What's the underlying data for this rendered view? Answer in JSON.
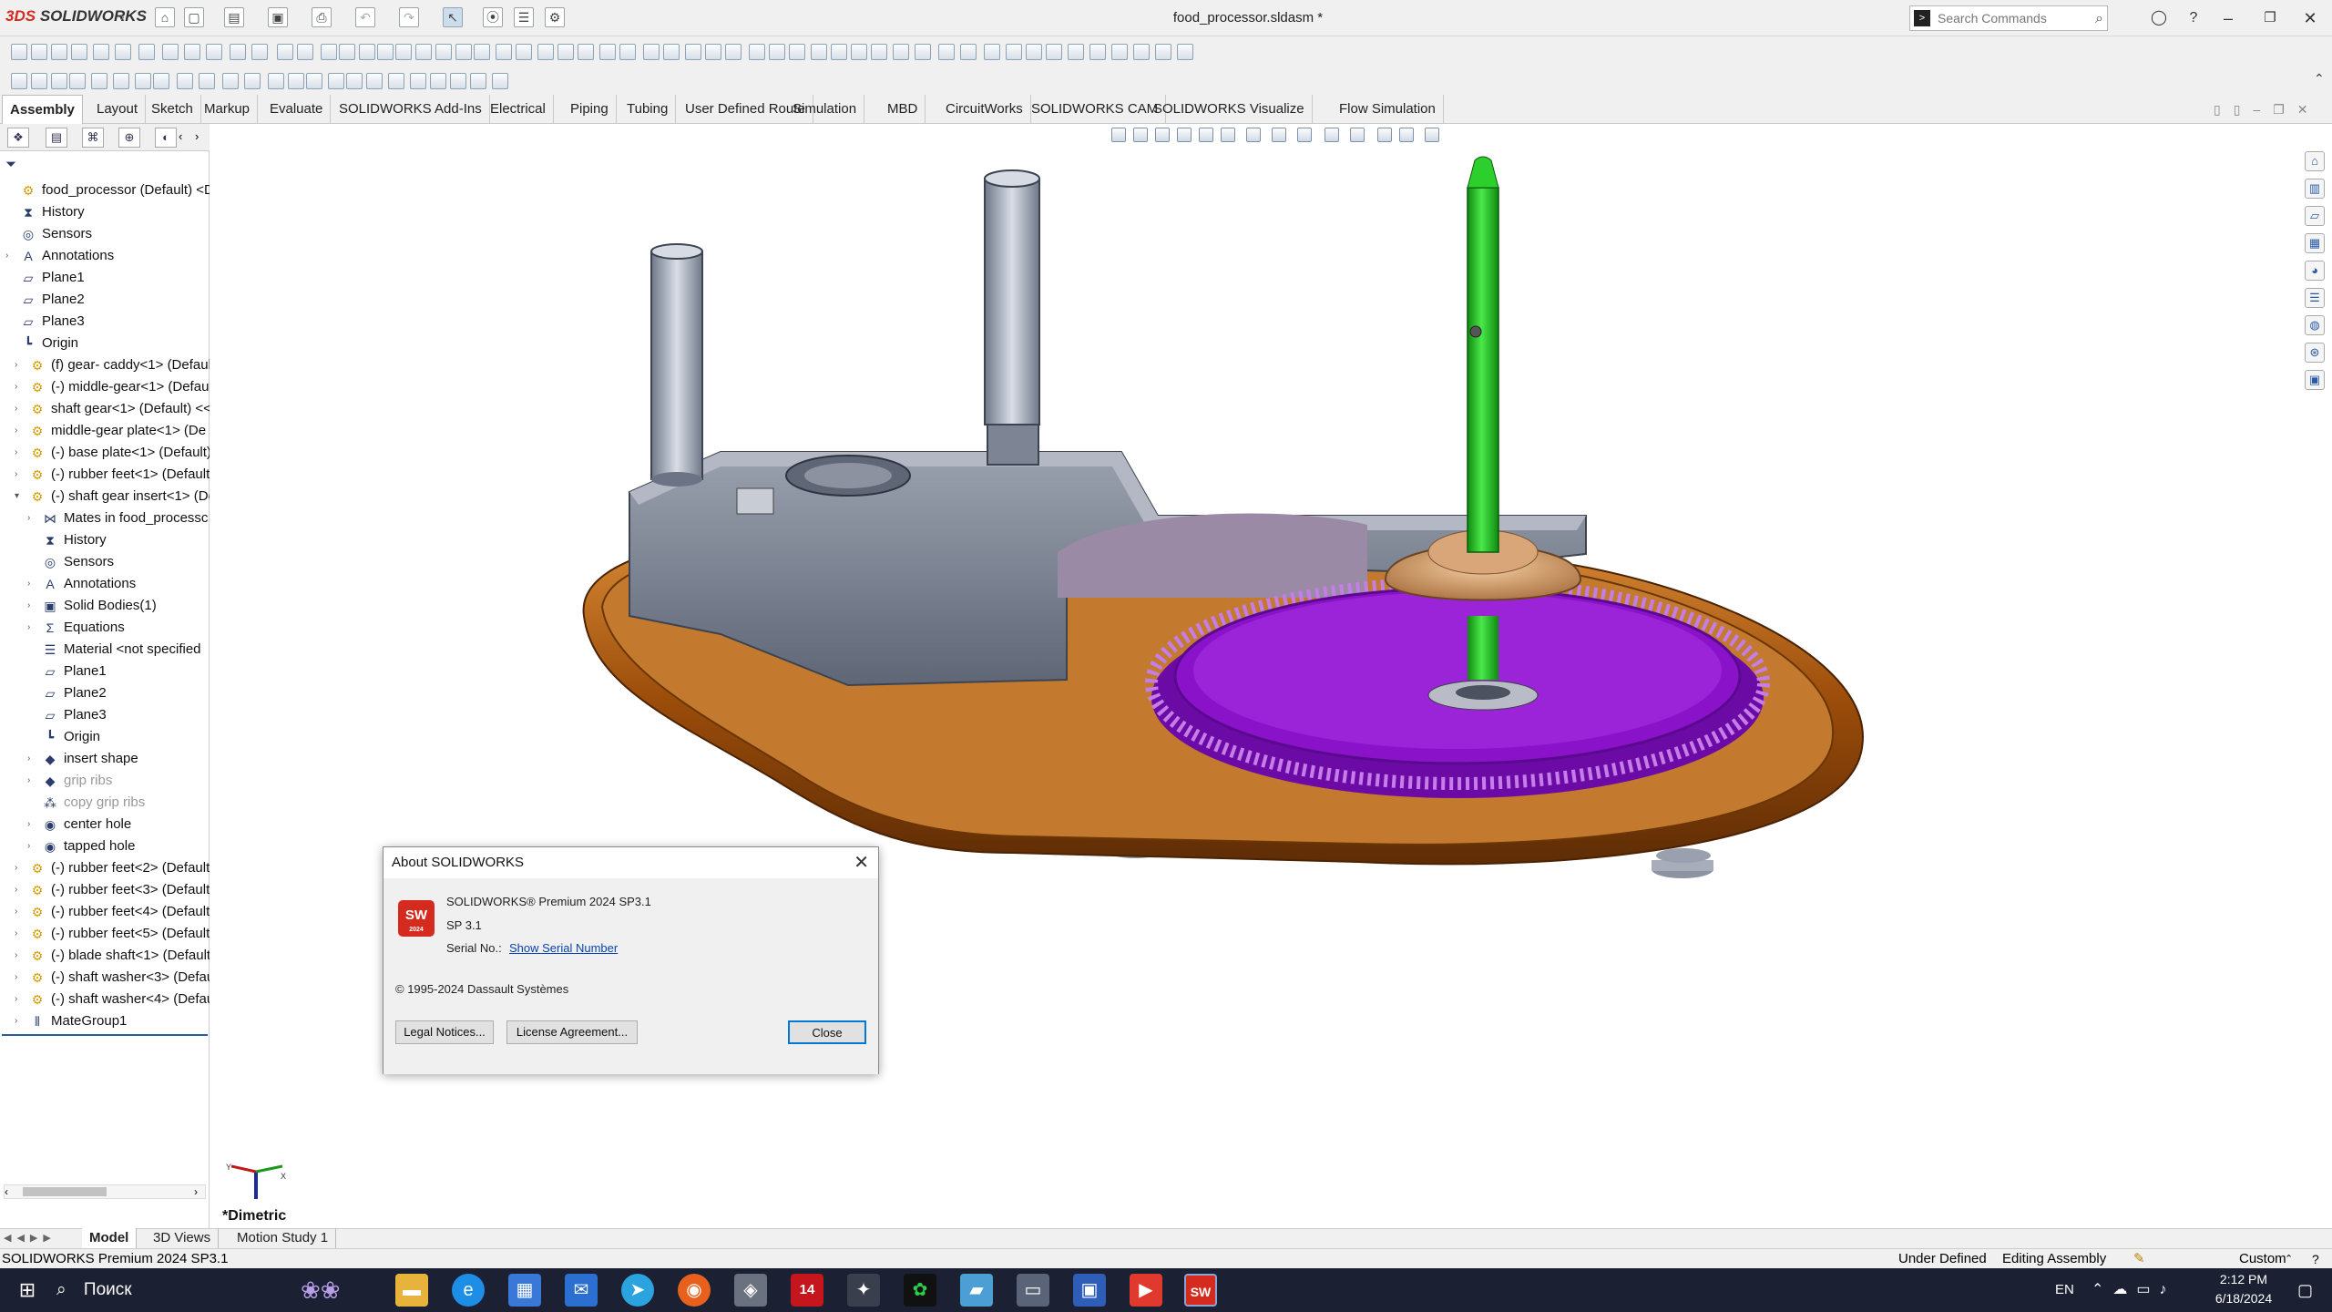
{
  "app": {
    "logo_brand": "SOLIDWORKS",
    "logo_ds": "3DS",
    "title": "food_processor.sldasm *"
  },
  "search": {
    "placeholder": "Search Commands"
  },
  "tabs": [
    "Assembly",
    "Layout",
    "Sketch",
    "Markup",
    "Evaluate",
    "SOLIDWORKS Add-Ins",
    "Electrical",
    "Piping",
    "Tubing",
    "User Defined Route",
    "Simulation",
    "MBD",
    "CircuitWorks",
    "SOLIDWORKS CAM",
    "SOLIDWORKS Visualize",
    "Flow Simulation"
  ],
  "tree": [
    {
      "label": "food_processor  (Default) <Def",
      "icon": "assembly-icon"
    },
    {
      "label": "History",
      "icon": "history-icon"
    },
    {
      "label": "Sensors",
      "icon": "sensors-icon"
    },
    {
      "label": "Annotations",
      "icon": "annotations-icon"
    },
    {
      "label": "Plane1",
      "icon": "plane-icon"
    },
    {
      "label": "Plane2",
      "icon": "plane-icon"
    },
    {
      "label": "Plane3",
      "icon": "plane-icon"
    },
    {
      "label": "Origin",
      "icon": "origin-icon"
    },
    {
      "label": "(f) gear- caddy<1> (Defaul",
      "icon": "part-icon"
    },
    {
      "label": "(-) middle-gear<1> (Defau",
      "icon": "part-icon"
    },
    {
      "label": "shaft gear<1> (Default) <<",
      "icon": "part-icon"
    },
    {
      "label": "middle-gear plate<1> (De",
      "icon": "part-icon"
    },
    {
      "label": "(-) base plate<1> (Default)",
      "icon": "part-icon"
    },
    {
      "label": "(-) rubber feet<1> (Default",
      "icon": "part-icon"
    },
    {
      "label": "(-) shaft gear insert<1> (De",
      "icon": "part-icon"
    },
    {
      "label": "Mates in food_processc",
      "icon": "mates-icon"
    },
    {
      "label": "History",
      "icon": "history-icon"
    },
    {
      "label": "Sensors",
      "icon": "sensors-icon"
    },
    {
      "label": "Annotations",
      "icon": "annotations-icon"
    },
    {
      "label": "Solid Bodies(1)",
      "icon": "solid-bodies-icon"
    },
    {
      "label": "Equations",
      "icon": "equations-icon"
    },
    {
      "label": "Material <not specified",
      "icon": "material-icon"
    },
    {
      "label": "Plane1",
      "icon": "plane-icon"
    },
    {
      "label": "Plane2",
      "icon": "plane-icon"
    },
    {
      "label": "Plane3",
      "icon": "plane-icon"
    },
    {
      "label": "Origin",
      "icon": "origin-icon"
    },
    {
      "label": "insert shape",
      "icon": "feature-icon"
    },
    {
      "label": "grip ribs",
      "icon": "feature-icon"
    },
    {
      "label": "copy grip ribs",
      "icon": "pattern-icon"
    },
    {
      "label": "center hole",
      "icon": "hole-icon"
    },
    {
      "label": "tapped hole",
      "icon": "hole-icon"
    },
    {
      "label": "(-) rubber feet<2> (Default",
      "icon": "part-icon"
    },
    {
      "label": "(-) rubber feet<3> (Default",
      "icon": "part-icon"
    },
    {
      "label": "(-) rubber feet<4> (Default",
      "icon": "part-icon"
    },
    {
      "label": "(-) rubber feet<5> (Default",
      "icon": "part-icon"
    },
    {
      "label": "(-) blade shaft<1> (Default",
      "icon": "part-icon"
    },
    {
      "label": "(-) shaft washer<3> (Defau",
      "icon": "part-icon"
    },
    {
      "label": "(-) shaft washer<4> (Defau",
      "icon": "part-icon"
    },
    {
      "label": "MateGroup1",
      "icon": "mategroup-icon"
    }
  ],
  "view": {
    "orientation": "*Dimetric"
  },
  "dialog": {
    "title": "About SOLIDWORKS",
    "logo_text": "SW",
    "logo_year": "2024",
    "product": "SOLIDWORKS® Premium 2024 SP3.1",
    "sp": "SP 3.1",
    "serial_label": "Serial No.:",
    "serial_link": "Show Serial Number",
    "copyright": "© 1995-2024 Dassault Systèmes",
    "legal_button": "Legal Notices...",
    "license_button": "License Agreement...",
    "close_button": "Close"
  },
  "bottom_tabs": [
    "Model",
    "3D Views",
    "Motion Study 1"
  ],
  "status": {
    "left": "SOLIDWORKS Premium 2024 SP3.1",
    "under_defined": "Under Defined",
    "editing": "Editing Assembly",
    "units": "Custom"
  },
  "taskbar": {
    "search": "Поиск",
    "lang": "EN",
    "time": "2:12 PM",
    "date": "6/18/2024",
    "notif_badge": "14"
  },
  "colors": {
    "accent": "#d52b1e",
    "shaft": "#18c418",
    "gear": "#8a12c8",
    "base": "#b8620e",
    "plate": "#7d8595"
  }
}
